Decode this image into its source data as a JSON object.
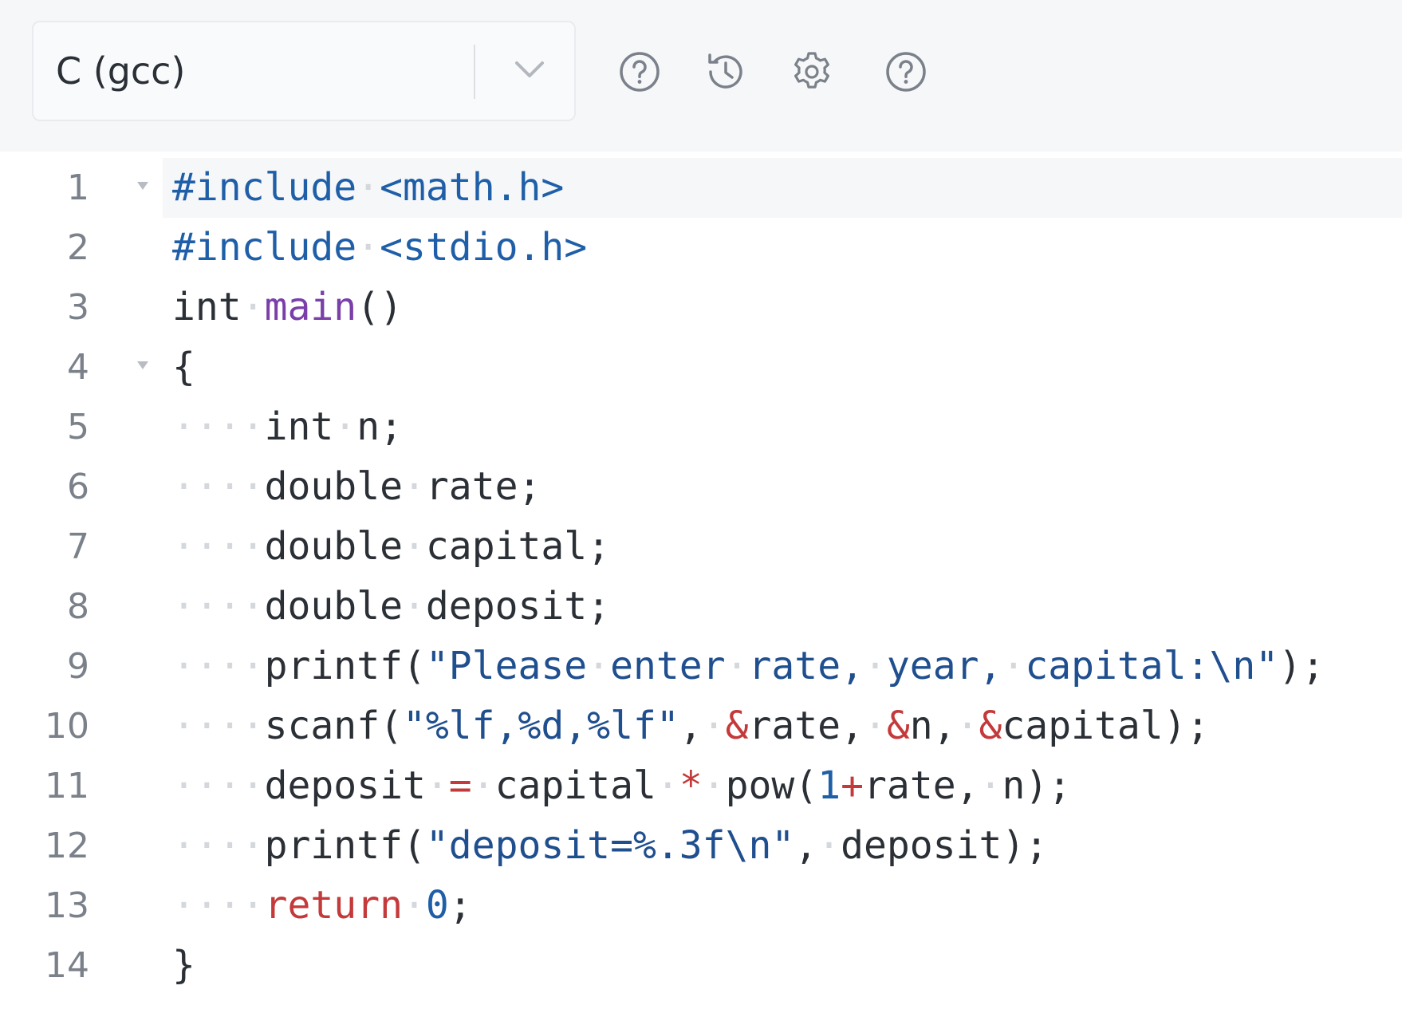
{
  "toolbar": {
    "language": "C (gcc)",
    "icons": [
      "help-circle-icon",
      "history-icon",
      "settings-gear-icon",
      "help-circle-icon"
    ]
  },
  "editor": {
    "lines": [
      {
        "num": "1",
        "tokens": [
          [
            "kw-pre",
            "#include"
          ],
          [
            "ws",
            "·"
          ],
          [
            "hdr",
            "<math.h>"
          ]
        ]
      },
      {
        "num": "2",
        "tokens": [
          [
            "kw-pre",
            "#include"
          ],
          [
            "ws",
            "·"
          ],
          [
            "hdr",
            "<stdio.h>"
          ]
        ]
      },
      {
        "num": "3",
        "tokens": [
          [
            "type",
            "int"
          ],
          [
            "ws",
            "·"
          ],
          [
            "fn",
            "main"
          ],
          [
            "type",
            "()"
          ]
        ]
      },
      {
        "num": "4",
        "tokens": [
          [
            "type",
            "{"
          ]
        ]
      },
      {
        "num": "5",
        "tokens": [
          [
            "ws",
            "····"
          ],
          [
            "type",
            "int"
          ],
          [
            "ws",
            "·"
          ],
          [
            "type",
            "n;"
          ]
        ]
      },
      {
        "num": "6",
        "tokens": [
          [
            "ws",
            "····"
          ],
          [
            "type",
            "double"
          ],
          [
            "ws",
            "·"
          ],
          [
            "type",
            "rate;"
          ]
        ]
      },
      {
        "num": "7",
        "tokens": [
          [
            "ws",
            "····"
          ],
          [
            "type",
            "double"
          ],
          [
            "ws",
            "·"
          ],
          [
            "type",
            "capital;"
          ]
        ]
      },
      {
        "num": "8",
        "tokens": [
          [
            "ws",
            "····"
          ],
          [
            "type",
            "double"
          ],
          [
            "ws",
            "·"
          ],
          [
            "type",
            "deposit;"
          ]
        ]
      },
      {
        "num": "9",
        "tokens": [
          [
            "ws",
            "····"
          ],
          [
            "type",
            "printf("
          ],
          [
            "str",
            "\"Please"
          ],
          [
            "ws",
            "·"
          ],
          [
            "str",
            "enter"
          ],
          [
            "ws",
            "·"
          ],
          [
            "str",
            "rate,"
          ],
          [
            "ws",
            "·"
          ],
          [
            "str",
            "year,"
          ],
          [
            "ws",
            "·"
          ],
          [
            "str",
            "capital:\\n\""
          ],
          [
            "type",
            ");"
          ]
        ]
      },
      {
        "num": "10",
        "tokens": [
          [
            "ws",
            "····"
          ],
          [
            "type",
            "scanf("
          ],
          [
            "str",
            "\"%lf,%d,%lf\""
          ],
          [
            "type",
            ","
          ],
          [
            "ws",
            "·"
          ],
          [
            "op",
            "&"
          ],
          [
            "type",
            "rate,"
          ],
          [
            "ws",
            "·"
          ],
          [
            "op",
            "&"
          ],
          [
            "type",
            "n,"
          ],
          [
            "ws",
            "·"
          ],
          [
            "op",
            "&"
          ],
          [
            "type",
            "capital);"
          ]
        ]
      },
      {
        "num": "11",
        "tokens": [
          [
            "ws",
            "····"
          ],
          [
            "type",
            "deposit"
          ],
          [
            "ws",
            "·"
          ],
          [
            "op",
            "="
          ],
          [
            "ws",
            "·"
          ],
          [
            "type",
            "capital"
          ],
          [
            "ws",
            "·"
          ],
          [
            "op",
            "*"
          ],
          [
            "ws",
            "·"
          ],
          [
            "type",
            "pow("
          ],
          [
            "num",
            "1"
          ],
          [
            "op",
            "+"
          ],
          [
            "type",
            "rate,"
          ],
          [
            "ws",
            "·"
          ],
          [
            "type",
            "n);"
          ]
        ]
      },
      {
        "num": "12",
        "tokens": [
          [
            "ws",
            "····"
          ],
          [
            "type",
            "printf("
          ],
          [
            "str",
            "\"deposit=%.3f\\n\""
          ],
          [
            "type",
            ","
          ],
          [
            "ws",
            "·"
          ],
          [
            "type",
            "deposit);"
          ]
        ]
      },
      {
        "num": "13",
        "tokens": [
          [
            "ws",
            "····"
          ],
          [
            "ret",
            "return"
          ],
          [
            "ws",
            "·"
          ],
          [
            "num",
            "0"
          ],
          [
            "type",
            ";"
          ]
        ]
      },
      {
        "num": "14",
        "tokens": [
          [
            "type",
            "}"
          ]
        ]
      }
    ],
    "folds": [
      "1",
      "4"
    ],
    "active_line": "1"
  }
}
